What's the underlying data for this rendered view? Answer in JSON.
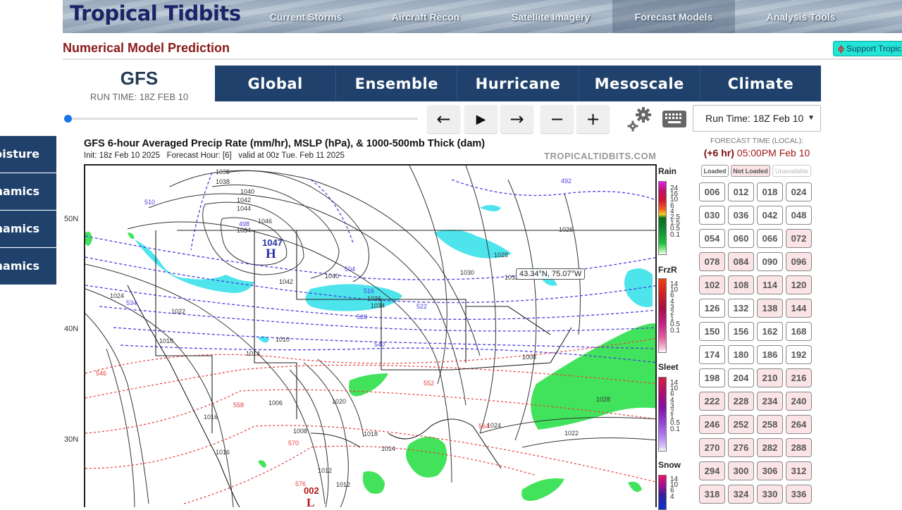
{
  "site": {
    "logo": "Tropical Tidbits",
    "nav": [
      "Current Storms",
      "Aircraft Recon",
      "Satellite Imagery",
      "Forecast Models",
      "Analysis Tools"
    ],
    "active_nav": "Forecast Models",
    "page_heading": "Numerical Model Prediction",
    "support_label": "Support Tropic"
  },
  "model": {
    "name": "GFS",
    "run_time": "RUN TIME: 18Z FEB 10",
    "categories": [
      "Global",
      "Ensemble",
      "Hurricane",
      "Mesoscale",
      "Climate"
    ]
  },
  "sidebar": {
    "items": [
      "oisture",
      "namics",
      "namics",
      "namics"
    ]
  },
  "controls": {
    "slider_position": 0,
    "prev_icon": "arrow-left-icon",
    "play_icon": "play-icon",
    "next_icon": "arrow-right-icon",
    "zoom_out_icon": "minus-icon",
    "zoom_in_icon": "plus-icon",
    "settings_icon": "gears-icon",
    "keyboard_icon": "keyboard-icon",
    "run_select": "Run Time: 18Z Feb 10"
  },
  "map": {
    "title": "GFS 6-hour Averaged Precip Rate (mm/hr), MSLP (hPa), & 1000-500mb Thick (dam)",
    "subtitle": "Init: 18z Feb 10 2025   Forecast Hour: [6]   valid at 00z Tue. Feb 11 2025",
    "brand": "TROPICALTIDBITS.COM",
    "lat_labels": [
      "50N",
      "40N",
      "30N"
    ],
    "coord_readout": "43.34°N, 75.07°W",
    "high_center": {
      "pressure": "1047",
      "symbol": "H"
    },
    "low_center": {
      "pressure": "002",
      "symbol": "L"
    },
    "isobar_labels": [
      "1036",
      "1038",
      "1040",
      "1042",
      "1044",
      "1046",
      "1040",
      "1042",
      "1036",
      "1034",
      "1032",
      "1030",
      "1028",
      "1026",
      "1024",
      "1022",
      "1020",
      "1018",
      "1016",
      "1014",
      "1012",
      "1010",
      "1008",
      "1006",
      "1034",
      "1028",
      "1024",
      "1022",
      "1018",
      "1016",
      "1014",
      "1012",
      "1008"
    ],
    "thickness_labels_blue": [
      "492",
      "498",
      "504",
      "510",
      "516",
      "522",
      "528",
      "534",
      "540"
    ],
    "thickness_labels_red": [
      "546",
      "552",
      "558",
      "564",
      "570",
      "576"
    ]
  },
  "legends": [
    {
      "title": "Rain",
      "ticks": [
        "24",
        "16",
        "10",
        "6",
        "4",
        "2.5",
        "1.5",
        "0.5",
        "0.1"
      ]
    },
    {
      "title": "FrzR",
      "ticks": [
        "14",
        "10",
        "6",
        "4",
        "3",
        "2",
        "1",
        "0.5",
        "0.1"
      ]
    },
    {
      "title": "Sleet",
      "ticks": [
        "14",
        "10",
        "6",
        "4",
        "3",
        "2",
        "1",
        "0.5",
        "0.1"
      ]
    },
    {
      "title": "Snow",
      "ticks": [
        "14",
        "10",
        "6",
        "4"
      ]
    }
  ],
  "forecast": {
    "label": "FORECAST TIME (LOCAL):",
    "offset": "(+6 hr)",
    "time": "05:00PM Feb 10",
    "status_keys": [
      "Loaded",
      "Not Loaded",
      "Unavailable"
    ],
    "hours": [
      {
        "h": "006",
        "s": "loaded"
      },
      {
        "h": "012",
        "s": "loaded"
      },
      {
        "h": "018",
        "s": "loaded"
      },
      {
        "h": "024",
        "s": "loaded"
      },
      {
        "h": "030",
        "s": "loaded"
      },
      {
        "h": "036",
        "s": "loaded"
      },
      {
        "h": "042",
        "s": "loaded"
      },
      {
        "h": "048",
        "s": "loaded"
      },
      {
        "h": "054",
        "s": "loaded"
      },
      {
        "h": "060",
        "s": "loaded"
      },
      {
        "h": "066",
        "s": "loaded"
      },
      {
        "h": "072",
        "s": "not-loaded"
      },
      {
        "h": "078",
        "s": "not-loaded"
      },
      {
        "h": "084",
        "s": "not-loaded"
      },
      {
        "h": "090",
        "s": "loaded"
      },
      {
        "h": "096",
        "s": "not-loaded"
      },
      {
        "h": "102",
        "s": "not-loaded"
      },
      {
        "h": "108",
        "s": "not-loaded"
      },
      {
        "h": "114",
        "s": "not-loaded"
      },
      {
        "h": "120",
        "s": "not-loaded"
      },
      {
        "h": "126",
        "s": "loaded"
      },
      {
        "h": "132",
        "s": "loaded"
      },
      {
        "h": "138",
        "s": "not-loaded"
      },
      {
        "h": "144",
        "s": "not-loaded"
      },
      {
        "h": "150",
        "s": "loaded"
      },
      {
        "h": "156",
        "s": "loaded"
      },
      {
        "h": "162",
        "s": "loaded"
      },
      {
        "h": "168",
        "s": "loaded"
      },
      {
        "h": "174",
        "s": "loaded"
      },
      {
        "h": "180",
        "s": "loaded"
      },
      {
        "h": "186",
        "s": "loaded"
      },
      {
        "h": "192",
        "s": "loaded"
      },
      {
        "h": "198",
        "s": "loaded"
      },
      {
        "h": "204",
        "s": "loaded"
      },
      {
        "h": "210",
        "s": "not-loaded"
      },
      {
        "h": "216",
        "s": "not-loaded"
      },
      {
        "h": "222",
        "s": "not-loaded"
      },
      {
        "h": "228",
        "s": "not-loaded"
      },
      {
        "h": "234",
        "s": "not-loaded"
      },
      {
        "h": "240",
        "s": "not-loaded"
      },
      {
        "h": "246",
        "s": "not-loaded"
      },
      {
        "h": "252",
        "s": "not-loaded"
      },
      {
        "h": "258",
        "s": "not-loaded"
      },
      {
        "h": "264",
        "s": "not-loaded"
      },
      {
        "h": "270",
        "s": "not-loaded"
      },
      {
        "h": "276",
        "s": "not-loaded"
      },
      {
        "h": "282",
        "s": "not-loaded"
      },
      {
        "h": "288",
        "s": "not-loaded"
      },
      {
        "h": "294",
        "s": "not-loaded"
      },
      {
        "h": "300",
        "s": "not-loaded"
      },
      {
        "h": "306",
        "s": "not-loaded"
      },
      {
        "h": "312",
        "s": "not-loaded"
      },
      {
        "h": "318",
        "s": "not-loaded"
      },
      {
        "h": "324",
        "s": "not-loaded"
      },
      {
        "h": "330",
        "s": "not-loaded"
      },
      {
        "h": "336",
        "s": "not-loaded"
      }
    ]
  },
  "colors": {
    "nav_dark": "#1f416b",
    "heading_red": "#8b1a1a",
    "support_bg": "#22e5d6",
    "not_loaded_bg": "#fbe4e6",
    "slider_thumb": "#1a73e8",
    "precip_rain": "#2ee04a",
    "precip_snow": "#2ee0e8",
    "thickness_cold": "#4a3fe0",
    "thickness_warm": "#e83c3c"
  }
}
